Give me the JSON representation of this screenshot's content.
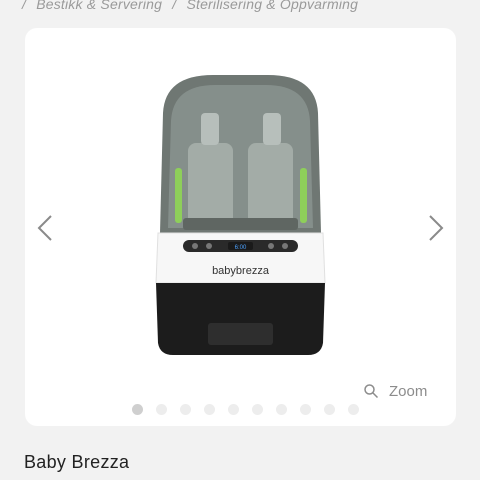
{
  "breadcrumb": {
    "separator": "/",
    "items": [
      "Bestikk & Servering",
      "Sterilisering & Oppvarming"
    ]
  },
  "gallery": {
    "zoom_label": "Zoom",
    "dot_count": 10,
    "active_index": 0,
    "product_logo": "babybrezza",
    "display_readout": "6:00"
  },
  "product": {
    "title": "Baby Brezza"
  },
  "colors": {
    "background": "#f2f2f2",
    "card": "#ffffff",
    "dot_active": "#cfcfcf",
    "dot_inactive": "#ededed",
    "accent_green": "#8ecf5a"
  }
}
